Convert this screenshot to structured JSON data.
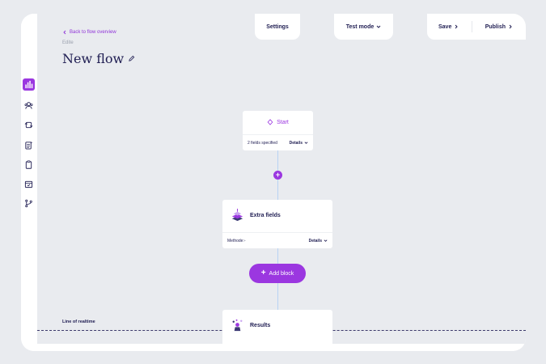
{
  "header": {
    "back_label": "Back to flow overview",
    "edit_label": "Edite",
    "title": "New flow"
  },
  "tabs": {
    "settings": "Settings",
    "test_mode": "Test mode",
    "save": "Save",
    "publish": "Publish"
  },
  "sidebar": {
    "items": [
      {
        "icon": "analytics-icon",
        "active": true
      },
      {
        "icon": "users-icon",
        "active": false
      },
      {
        "icon": "sync-icon",
        "active": false
      },
      {
        "icon": "document-list-icon",
        "active": false
      },
      {
        "icon": "clipboard-icon",
        "active": false
      },
      {
        "icon": "inbox-icon",
        "active": false
      },
      {
        "icon": "branch-icon",
        "active": false
      }
    ]
  },
  "flow": {
    "start": {
      "label": "Start",
      "fields": "2 fields specified",
      "details": "Details"
    },
    "extra_fields": {
      "label": "Extra fields",
      "method": "Methode:-",
      "details": "Details"
    },
    "add_block": {
      "symbol": "+",
      "label": "Add block"
    },
    "realtime": {
      "label": "Line of realtime"
    },
    "results": {
      "label": "Results"
    }
  },
  "colors": {
    "accent": "#9b37e0",
    "text": "#1f1d52",
    "canvas": "#e9ebef",
    "connector": "#b8d3f4"
  }
}
